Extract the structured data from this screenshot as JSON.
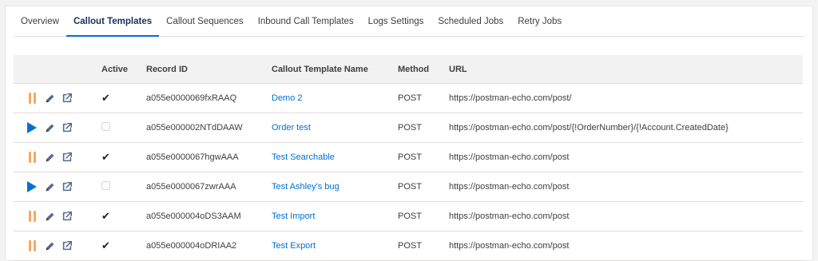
{
  "tabs": [
    {
      "label": "Overview",
      "active": false
    },
    {
      "label": "Callout Templates",
      "active": true
    },
    {
      "label": "Callout Sequences",
      "active": false
    },
    {
      "label": "Inbound Call Templates",
      "active": false
    },
    {
      "label": "Logs Settings",
      "active": false
    },
    {
      "label": "Scheduled Jobs",
      "active": false
    },
    {
      "label": "Retry Jobs",
      "active": false
    }
  ],
  "table": {
    "headers": {
      "active": "Active",
      "record_id": "Record ID",
      "name": "Callout Template Name",
      "method": "Method",
      "url": "URL"
    },
    "rows": [
      {
        "state": "pause",
        "active": true,
        "record_id": "a055e0000069fxRAAQ",
        "name": "Demo 2",
        "method": "POST",
        "url": "https://postman-echo.com/post/"
      },
      {
        "state": "play",
        "active": false,
        "record_id": "a055e000002NTdDAAW",
        "name": "Order test",
        "method": "POST",
        "url": "https://postman-echo.com/post/{!OrderNumber}/{!Account.CreatedDate}"
      },
      {
        "state": "pause",
        "active": true,
        "record_id": "a055e0000067hgwAAA",
        "name": "Test Searchable",
        "method": "POST",
        "url": "https://postman-echo.com/post"
      },
      {
        "state": "play",
        "active": false,
        "record_id": "a055e0000067zwrAAA",
        "name": "Test Ashley's bug",
        "method": "POST",
        "url": "https://postman-echo.com/post"
      },
      {
        "state": "pause",
        "active": true,
        "record_id": "a055e000004oDS3AAM",
        "name": "Test Import",
        "method": "POST",
        "url": "https://postman-echo.com/post"
      },
      {
        "state": "pause",
        "active": true,
        "record_id": "a055e000004oDRIAA2",
        "name": "Test Export",
        "method": "POST",
        "url": "https://postman-echo.com/post"
      }
    ]
  },
  "colors": {
    "accent": "#0070d2",
    "pause": "#f7a85c",
    "header_bg": "#f3f2f2"
  },
  "icons": {
    "pause": "pause-icon",
    "play": "play-icon",
    "edit": "pencil-icon",
    "export": "export-icon",
    "checked": "checkmark-icon"
  }
}
